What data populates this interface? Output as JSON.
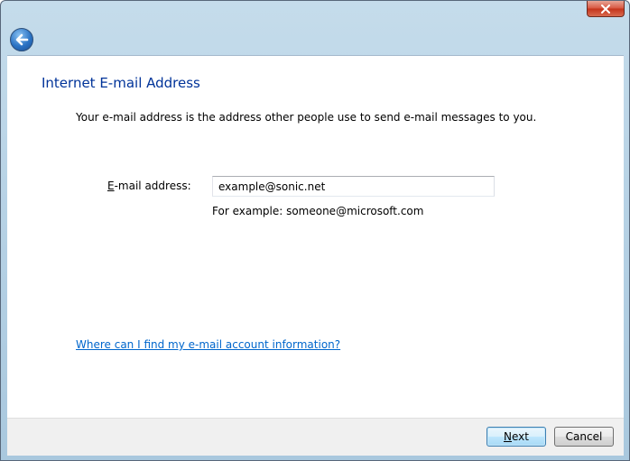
{
  "window": {
    "close_icon": "close-x-icon",
    "back_icon": "back-arrow-icon"
  },
  "page": {
    "heading": "Internet E-mail Address",
    "description": "Your e-mail address is the address other people use to send e-mail messages to you."
  },
  "form": {
    "email_label_mnemonic": "E",
    "email_label_rest": "-mail address:",
    "email_value": "example@sonic.net",
    "email_hint": "For example: someone@microsoft.com"
  },
  "help": {
    "link_text": "Where can I find my e-mail account information?"
  },
  "footer": {
    "next_mnemonic": "N",
    "next_rest": "ext",
    "cancel_label": "Cancel"
  },
  "colors": {
    "heading": "#003399",
    "link": "#0066cc"
  }
}
